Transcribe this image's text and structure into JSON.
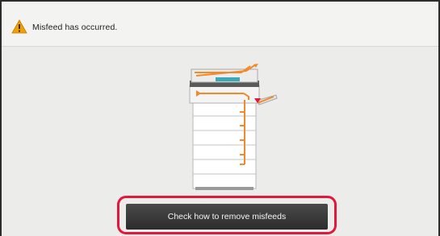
{
  "header": {
    "message": "Misfeed has occurred.",
    "icon": "warning-icon",
    "icon_color": "#f0a000"
  },
  "illustration": {
    "icon": "copier-misfeed-icon",
    "path_color": "#f08a2a",
    "panel_color": "#3aa9b8"
  },
  "action": {
    "label": "Check how to remove misfeeds",
    "highlight_color": "#e3163b"
  }
}
